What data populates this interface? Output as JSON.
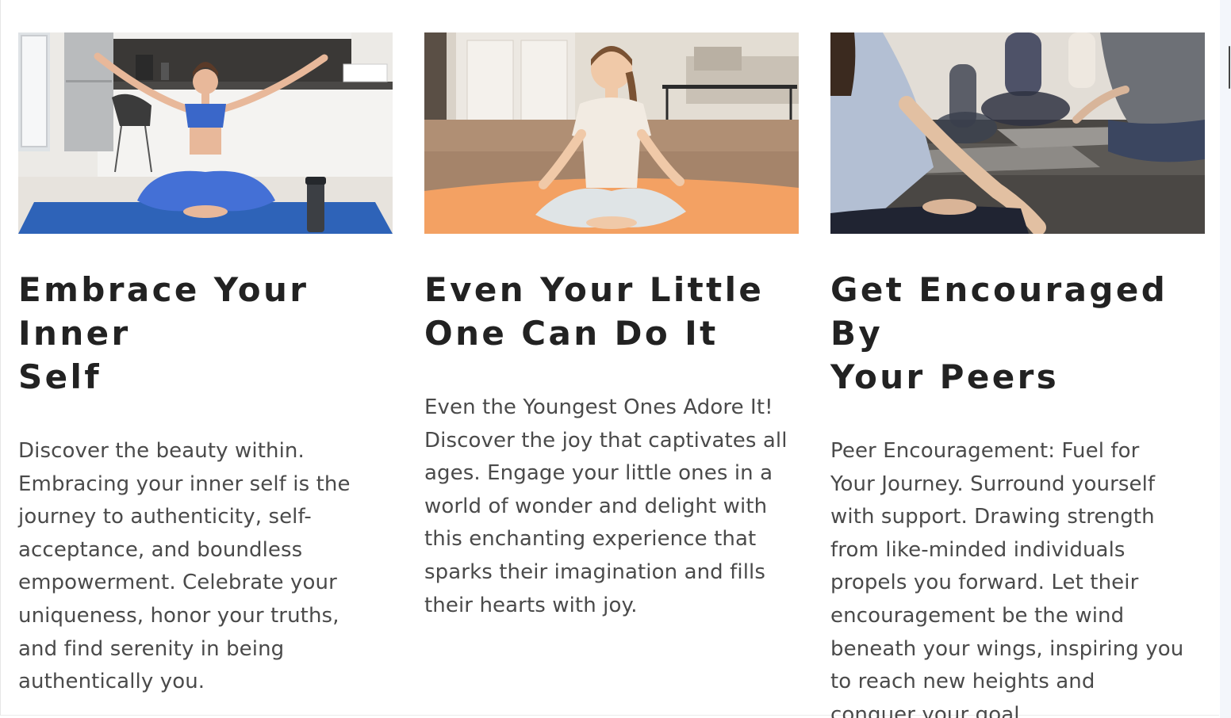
{
  "cards": [
    {
      "image_alt": "Woman meditating on a blue yoga mat in a kitchen",
      "title_lines": [
        "Embrace Your Inner",
        "Self"
      ],
      "body_lines": [
        "Discover the beauty within.",
        "Embracing your inner self is the",
        "journey to authenticity, self-",
        "acceptance, and boundless",
        "empowerment. Celebrate your",
        "uniqueness, honor your truths,",
        "and find serenity in being",
        "authentically you."
      ]
    },
    {
      "image_alt": "Young girl meditating cross-legged on an orange yoga mat",
      "title_lines": [
        "Even Your Little",
        "One Can Do It"
      ],
      "body_lines": [
        "Even the Youngest Ones Adore It!",
        "Discover the joy that captivates all",
        "ages. Engage your little ones in a",
        "world of wonder and delight with",
        "this enchanting experience that",
        "sparks their imagination and fills",
        "their hearts with joy."
      ]
    },
    {
      "image_alt": "Group of people meditating together in a yoga class",
      "title_lines": [
        "Get Encouraged By",
        "Your Peers"
      ],
      "body_lines": [
        "Peer Encouragement: Fuel for",
        "Your Journey. Surround yourself",
        "with support. Drawing strength",
        "from like-minded individuals",
        "propels you forward. Let their",
        "encouragement be the wind",
        "beneath your wings, inspiring you",
        "to reach new heights and",
        "conquer your goal"
      ]
    }
  ],
  "colors": {
    "title": "#222222",
    "body": "#4a4a4a",
    "background": "#ffffff"
  }
}
